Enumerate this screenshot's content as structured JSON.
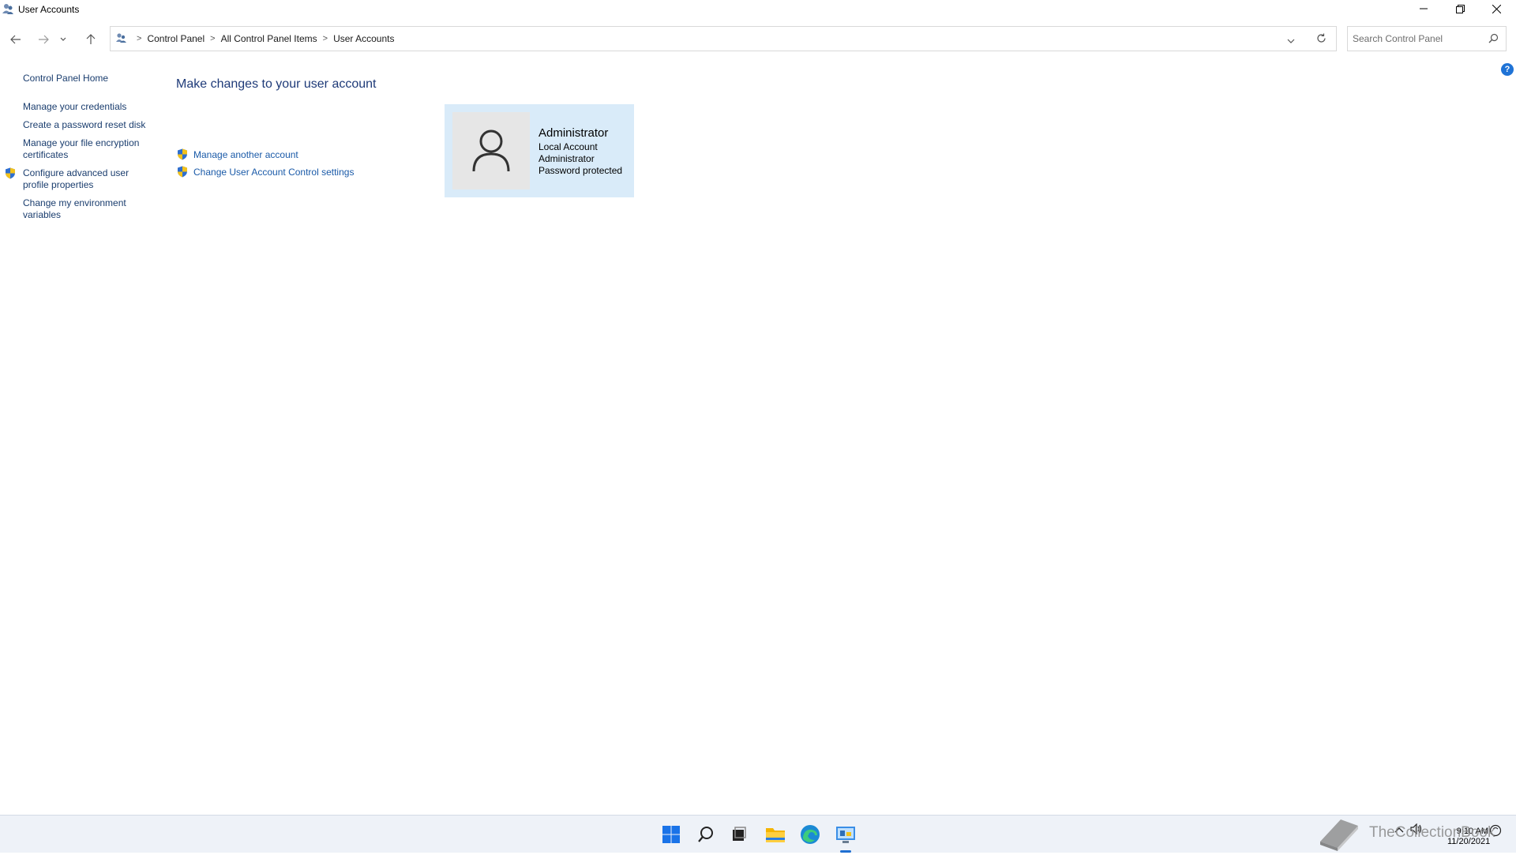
{
  "window": {
    "title": "User Accounts"
  },
  "address_bar": {
    "breadcrumbs": [
      "Control Panel",
      "All Control Panel Items",
      "User Accounts"
    ],
    "search_placeholder": "Search Control Panel"
  },
  "sidebar": {
    "items": [
      {
        "label": "Control Panel Home",
        "shield": false
      },
      {
        "label": "Manage your credentials",
        "shield": false
      },
      {
        "label": "Create a password reset disk",
        "shield": false
      },
      {
        "label": "Manage your file encryption certificates",
        "shield": false
      },
      {
        "label": "Configure advanced user profile properties",
        "shield": true
      },
      {
        "label": "Change my environment variables",
        "shield": false
      }
    ]
  },
  "main": {
    "title": "Make changes to your user account",
    "tasks": [
      {
        "label": "Manage another account",
        "icon": "uac-shield-icon"
      },
      {
        "label": "Change User Account Control settings",
        "icon": "uac-shield-icon"
      }
    ],
    "account": {
      "name": "Administrator",
      "type": "Local Account",
      "role": "Administrator",
      "status": "Password protected"
    }
  },
  "taskbar": {
    "icons": [
      "windows-start-icon",
      "search-icon",
      "task-view-icon",
      "file-explorer-icon",
      "edge-browser-icon",
      "control-panel-icon"
    ],
    "time": "9:10 AM",
    "date": "11/20/2021"
  },
  "watermark": {
    "text": "TheCollectionBook"
  },
  "colors": {
    "link": "#1a5aa8",
    "heading": "#1e3a78",
    "card_bg": "#d9ebf9",
    "accent": "#1f6fd1"
  }
}
